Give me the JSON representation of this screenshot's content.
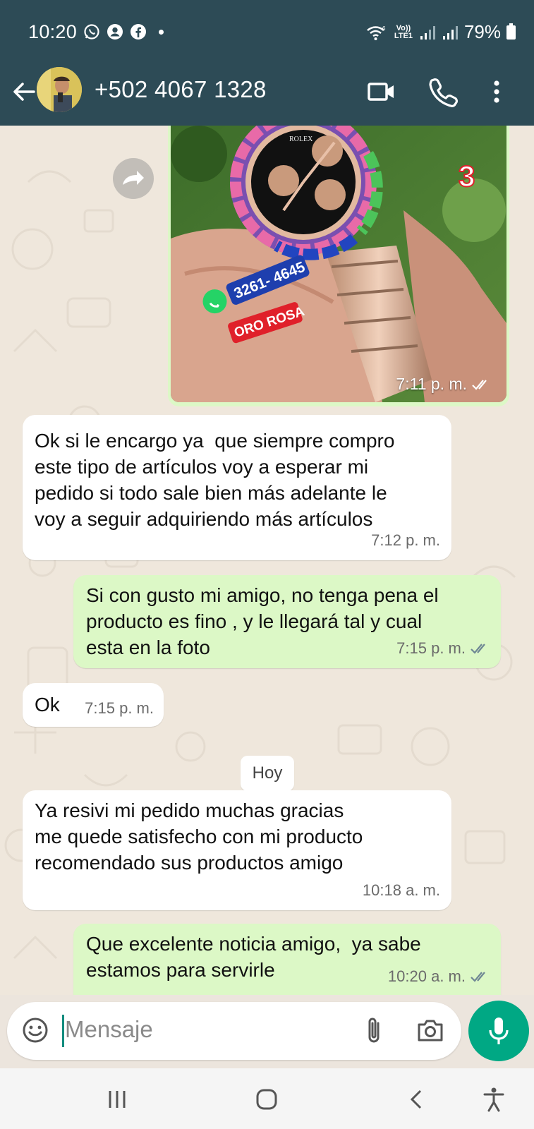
{
  "status_bar": {
    "time": "10:20",
    "battery": "79%",
    "network_label": "Vo)) LTE1",
    "left_icons": [
      "whatsapp-icon",
      "account-icon",
      "facebook-icon",
      "dot"
    ],
    "right_icons": [
      "wifi-icon",
      "volte-icon",
      "signal-1-icon",
      "signal-2-icon",
      "battery-icon"
    ]
  },
  "header": {
    "contact": "+502 4067 1328",
    "icons": [
      "back-arrow-icon",
      "avatar",
      "video-call-icon",
      "phone-icon",
      "more-vert-icon"
    ]
  },
  "photo_overlay": {
    "badge_number": "3",
    "phone_text": "3261- 4645",
    "color_label": "ORO ROSA",
    "watch_brand": "ROLEX"
  },
  "messages": [
    {
      "dir": "out",
      "type": "image",
      "time": "7:11 p. m.",
      "read": true
    },
    {
      "dir": "in",
      "text": "Ok si le encargo ya  que siempre compro\neste tipo de artículos voy a esperar mi\npedido si todo sale bien más adelante le\nvoy a seguir adquiriendo más artículos",
      "time": "7:12 p. m."
    },
    {
      "dir": "out",
      "text": "Si con gusto mi amigo, no tenga pena el\nproducto es fino , y le llegará tal y cual\nesta en la foto",
      "time": "7:15 p. m.",
      "read": true
    },
    {
      "dir": "in",
      "text": "Ok",
      "time": "7:15 p. m."
    },
    {
      "dir": "in",
      "text": "Ya resivi mi pedido muchas gracias\nme quede satisfecho con mi producto\nrecomendado sus productos amigo",
      "time": "10:18 a. m."
    },
    {
      "dir": "out",
      "text": "Que excelente noticia amigo,  ya sabe\nestamos para servirle",
      "time": "10:20 a. m.",
      "read": true
    }
  ],
  "day_separator": "Hoy",
  "composer": {
    "placeholder": "Mensaje",
    "icons": [
      "emoji-icon",
      "attach-icon",
      "camera-icon",
      "mic-icon"
    ]
  },
  "nav_bar": {
    "icons": [
      "recents-icon",
      "home-icon",
      "back-icon",
      "accessibility-icon"
    ]
  },
  "colors": {
    "header_bg": "#2d4b56",
    "chat_bg": "#efe7dc",
    "incoming_bubble": "#ffffff",
    "outgoing_bubble": "#dcf8c6",
    "accent": "#00a884",
    "ticks": "#5a6e7a"
  }
}
